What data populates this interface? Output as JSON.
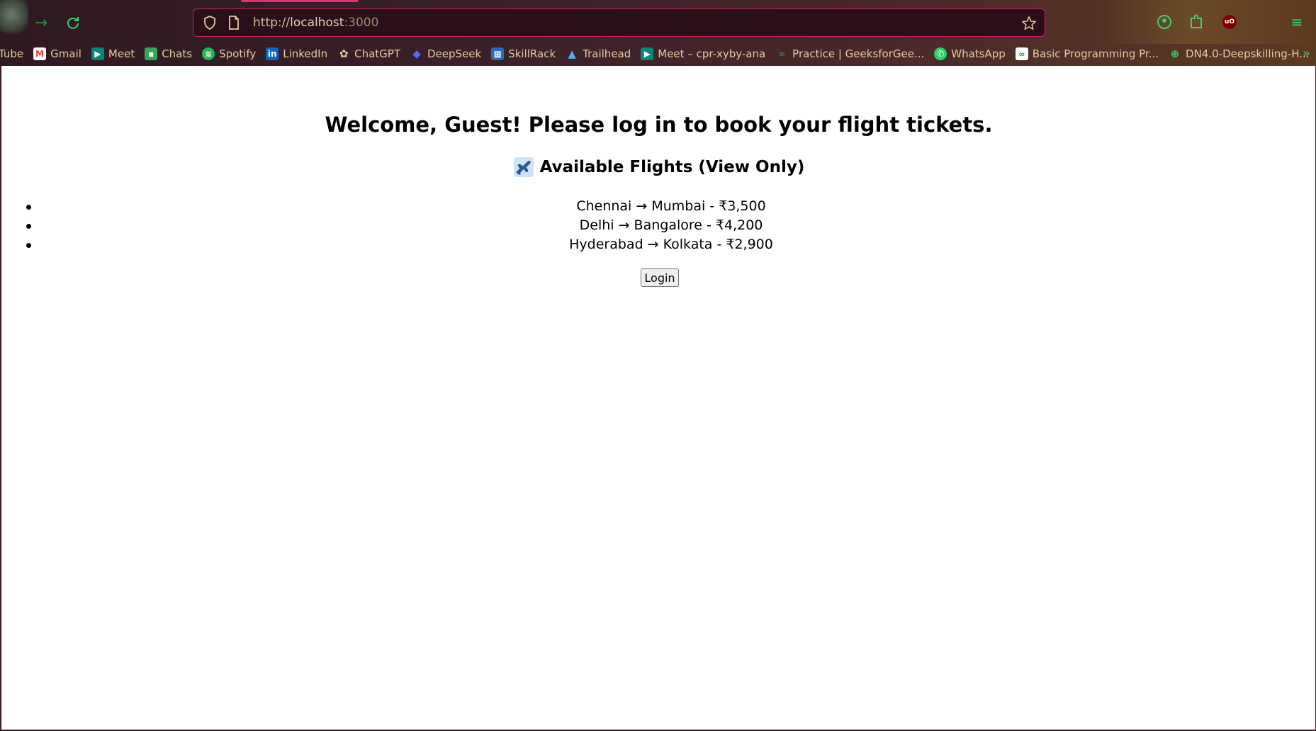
{
  "browser": {
    "url": {
      "scheme": "http://",
      "host": "localhost",
      "port": ":3000"
    },
    "bookmarks": [
      {
        "label": "Tube",
        "icon": "youtube-icon",
        "color": "#ff0000"
      },
      {
        "label": "Gmail",
        "icon": "gmail-icon",
        "color": "#ea4335"
      },
      {
        "label": "Meet",
        "icon": "meet-icon",
        "color": "#00897b"
      },
      {
        "label": "Chats",
        "icon": "chat-icon",
        "color": "#34a853"
      },
      {
        "label": "Spotify",
        "icon": "spotify-icon",
        "color": "#1db954"
      },
      {
        "label": "LinkedIn",
        "icon": "linkedin-icon",
        "color": "#0a66c2"
      },
      {
        "label": "ChatGPT",
        "icon": "chatgpt-icon",
        "color": "#5a5a5a"
      },
      {
        "label": "DeepSeek",
        "icon": "deepseek-icon",
        "color": "#4d6bfe"
      },
      {
        "label": "SkillRack",
        "icon": "skillrack-icon",
        "color": "#2a6ab8"
      },
      {
        "label": "Trailhead",
        "icon": "trailhead-icon",
        "color": "#2f7fd8"
      },
      {
        "label": "Meet – cpr-xyby-ana",
        "icon": "meet-icon",
        "color": "#00897b"
      },
      {
        "label": "Practice | GeeksforGee...",
        "icon": "gfg-icon",
        "color": "#2f8d46"
      },
      {
        "label": "WhatsApp",
        "icon": "whatsapp-icon",
        "color": "#25d366"
      },
      {
        "label": "Basic Programming Pr...",
        "icon": "gfg-icon",
        "color": "#2f8d46"
      },
      {
        "label": "DN4.0-Deepskilling-H...",
        "icon": "globe-icon",
        "color": "#3bd16f"
      }
    ]
  },
  "page": {
    "title": "Welcome, Guest! Please log in to book your flight tickets.",
    "subtitle": "Available Flights (View Only)",
    "flights": [
      "Chennai → Mumbai - ₹3,500",
      "Delhi → Bangalore - ₹4,200",
      "Hyderabad → Kolkata - ₹2,900"
    ],
    "login_label": "Login"
  },
  "colors": {
    "accent": "#3bd16f",
    "urlbar_border": "#c4245e"
  }
}
